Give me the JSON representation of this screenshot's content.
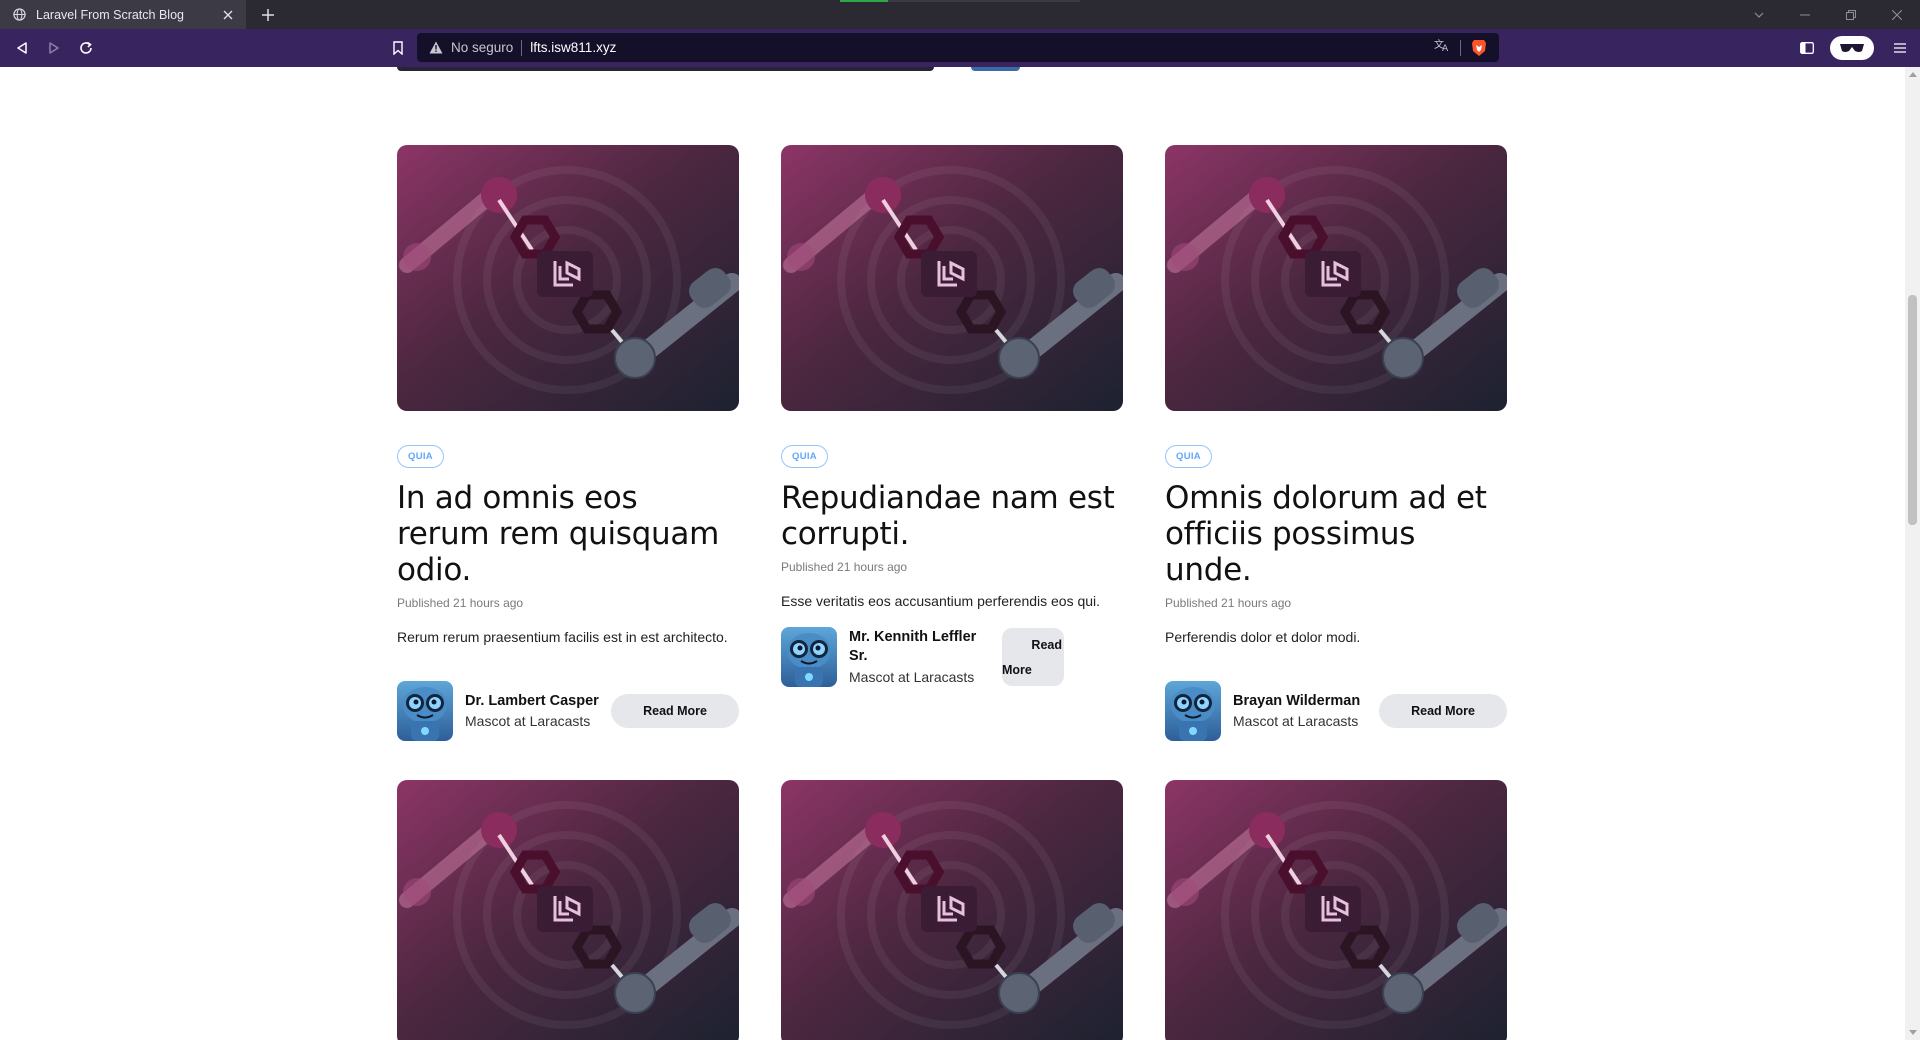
{
  "browser": {
    "tab_title": "Laravel From Scratch Blog",
    "security_label": "No seguro",
    "url": "lfts.isw811.xyz"
  },
  "posts": [
    {
      "category": "QUIA",
      "title": "In ad omnis eos rerum rem quisquam odio.",
      "published": "Published 21 hours ago",
      "excerpt": "Rerum rerum praesentium facilis est in est architecto.",
      "author_name": "Dr. Lambert Casper",
      "author_role": "Mascot at Laracasts",
      "read_more": "Read More"
    },
    {
      "category": "QUIA",
      "title": "Repudiandae nam est corrupti.",
      "published": "Published 21 hours ago",
      "excerpt": "Esse veritatis eos accusantium perferendis eos qui.",
      "author_name": "Mr. Kennith Leffler Sr.",
      "author_role": "Mascot at Laracasts",
      "read_more_line1": "Read",
      "read_more_line2": "More"
    },
    {
      "category": "QUIA",
      "title": "Omnis dolorum ad et officiis possimus unde.",
      "published": "Published 21 hours ago",
      "excerpt": "Perferendis dolor et dolor modi.",
      "author_name": "Brayan Wilderman",
      "author_role": "Mascot at Laracasts",
      "read_more": "Read More"
    }
  ],
  "colors": {
    "tag_border": "#93c5fd",
    "tag_text": "#60a5fa",
    "toolbar": "#38245f",
    "read_more_bg": "#e5e7eb"
  }
}
